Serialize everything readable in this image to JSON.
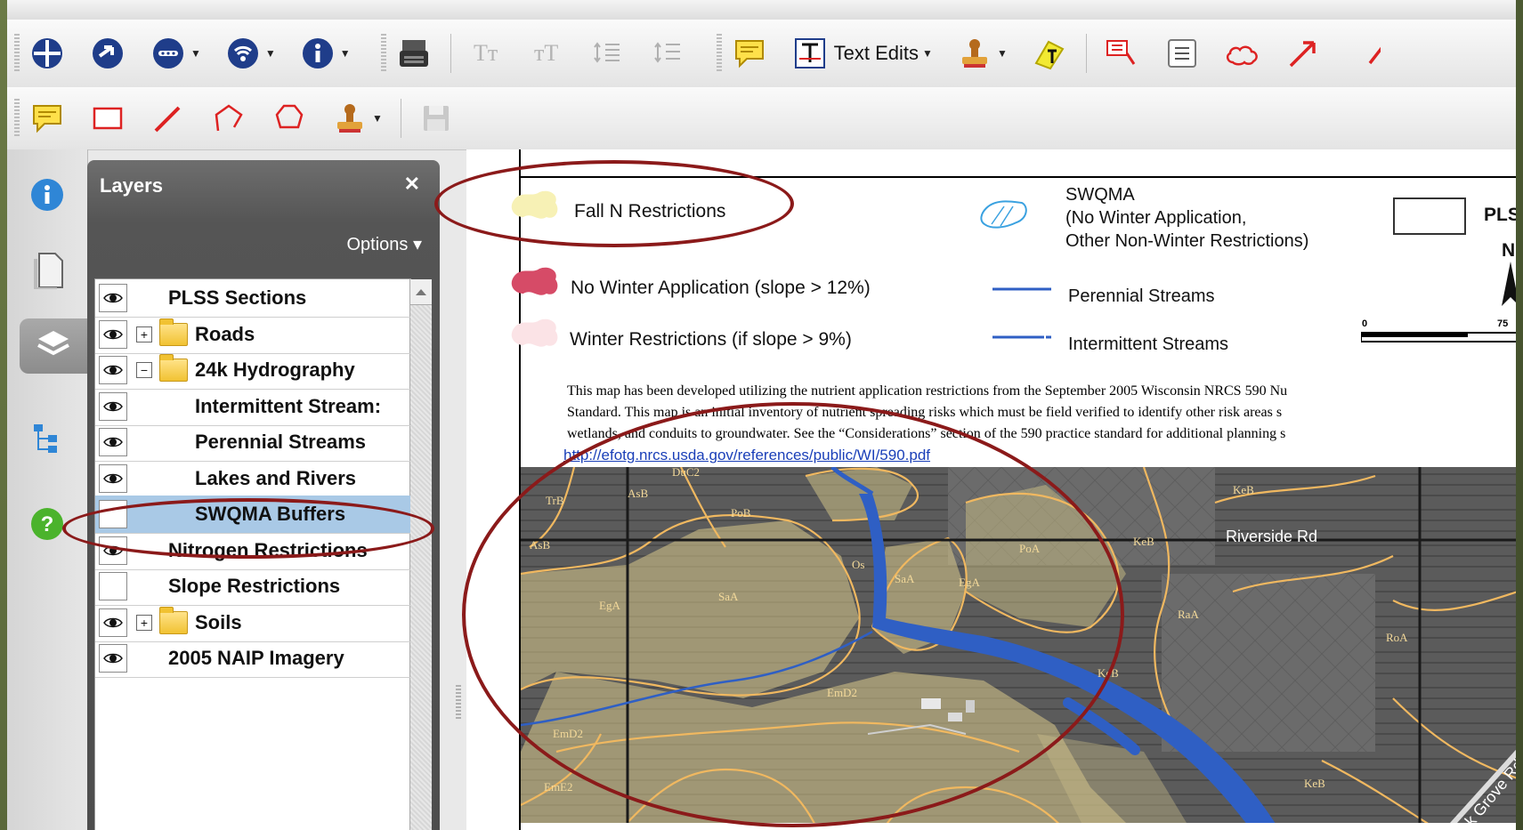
{
  "toolbar1": {
    "text_edits_label": "Text Edits"
  },
  "panel": {
    "title": "Layers",
    "close_glyph": "✕",
    "options_label": "Options ▾",
    "layers": [
      {
        "name": "PLSS Sections",
        "visible": true,
        "expander": "",
        "folder": false,
        "indent": 0
      },
      {
        "name": "Roads",
        "visible": true,
        "expander": "+",
        "folder": true,
        "indent": 0
      },
      {
        "name": "24k Hydrography",
        "visible": true,
        "expander": "−",
        "folder": true,
        "indent": 0
      },
      {
        "name": "Intermittent Stream:",
        "visible": true,
        "expander": "",
        "folder": false,
        "indent": 1
      },
      {
        "name": "Perennial Streams",
        "visible": true,
        "expander": "",
        "folder": false,
        "indent": 1
      },
      {
        "name": "Lakes and Rivers",
        "visible": true,
        "expander": "",
        "folder": false,
        "indent": 1
      },
      {
        "name": "SWQMA Buffers",
        "visible": false,
        "expander": "",
        "folder": false,
        "indent": 1,
        "selected": true
      },
      {
        "name": "Nitrogen Restrictions",
        "visible": true,
        "expander": "",
        "folder": false,
        "indent": 0
      },
      {
        "name": "Slope Restrictions",
        "visible": false,
        "expander": "",
        "folder": false,
        "indent": 0
      },
      {
        "name": "Soils",
        "visible": true,
        "expander": "+",
        "folder": true,
        "indent": 0
      },
      {
        "name": "2005 NAIP Imagery",
        "visible": true,
        "expander": "",
        "folder": false,
        "indent": 0
      }
    ]
  },
  "legend": {
    "fall_n": "Fall N Restrictions",
    "no_winter": "No Winter Application (slope > 12%)",
    "winter_restrictions": "Winter Restrictions (if slope > 9%)",
    "swqma_line1": "SWQMA",
    "swqma_line2": "(No Winter Application,",
    "swqma_line3": "Other Non-Winter Restrictions)",
    "perennial": "Perennial Streams",
    "intermittent": "Intermittent Streams",
    "plss": "PLS",
    "north": "N",
    "scale_zero": "0",
    "scale_end": "75"
  },
  "description": {
    "line1": "This map has been developed utilizing the nutrient application restrictions from the September 2005 Wisconsin NRCS 590 Nu",
    "line2": "Standard. This map is an initial inventory of nutrient spreading risks which must be field verified to identify other risk areas s",
    "line3": "wetlands, and conduits to groundwater. See the “Considerations” section of the 590 practice standard for additional planning s",
    "link": "http://efotg.nrcs.usda.gov/references/public/WI/590.pdf"
  },
  "map": {
    "road_label": "Riverside Rd",
    "road2_label": "Oak Grove Rd",
    "soil_labels": [
      "DuC2",
      "TrB",
      "AsB",
      "PoB",
      "KeB",
      "AsB",
      "PoA",
      "KeB",
      "Os",
      "SaA",
      "EgA",
      "SaA",
      "EgA",
      "RaA",
      "RoA",
      "KeB",
      "EmD2",
      "EmD2",
      "EmE2",
      "KeB"
    ]
  },
  "colors": {
    "annotation_ellipse": "#8b1a1a",
    "fall_n": "#f7f1b5",
    "no_winter": "#d64b67",
    "winter": "#fbe3e6",
    "stream": "#2f5fc4"
  }
}
